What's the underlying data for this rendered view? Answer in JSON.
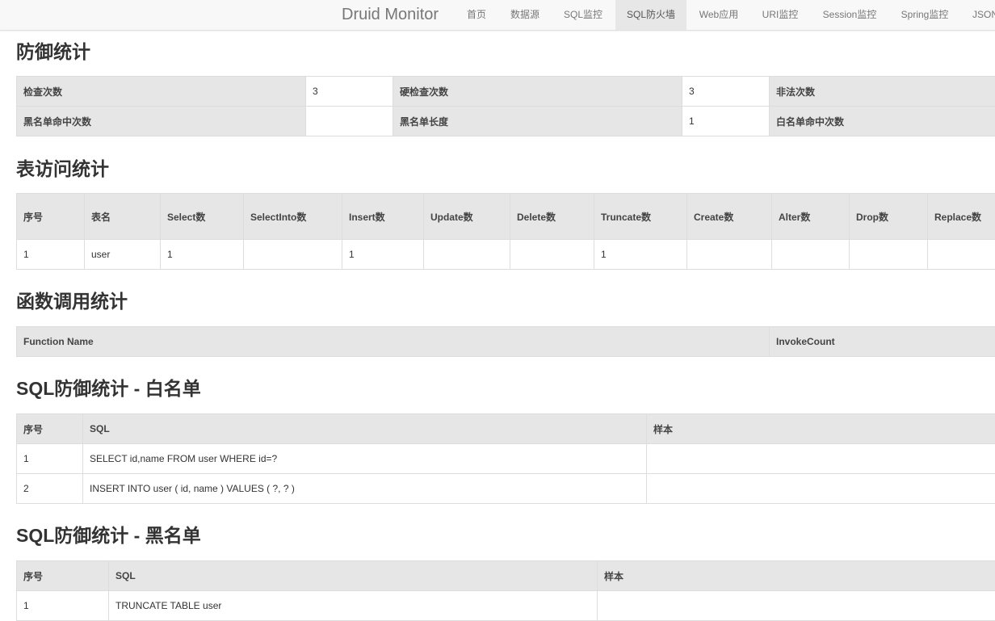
{
  "navbar": {
    "brand": "Druid Monitor",
    "items": [
      {
        "label": "首页"
      },
      {
        "label": "数据源"
      },
      {
        "label": "SQL监控"
      },
      {
        "label": "SQL防火墙"
      },
      {
        "label": "Web应用"
      },
      {
        "label": "URI监控"
      },
      {
        "label": "Session监控"
      },
      {
        "label": "Spring监控"
      },
      {
        "label": "JSON"
      }
    ],
    "active_item": "SQL防火墙"
  },
  "defense": {
    "title": "防御统计",
    "rows": [
      [
        {
          "label": "检查次数",
          "value": "3"
        },
        {
          "label": "硬检查次数",
          "value": "3"
        },
        {
          "label": "非法次数",
          "value": ""
        }
      ],
      [
        {
          "label": "黑名单命中次数",
          "value": ""
        },
        {
          "label": "黑名单长度",
          "value": "1"
        },
        {
          "label": "白名单命中次数",
          "value": ""
        }
      ]
    ]
  },
  "table_access": {
    "title": "表访问统计",
    "headers": [
      "序号",
      "表名",
      "Select数",
      "SelectInto数",
      "Insert数",
      "Update数",
      "Delete数",
      "Truncate数",
      "Create数",
      "Alter数",
      "Drop数",
      "Replace数"
    ],
    "rows": [
      [
        "1",
        "user",
        "1",
        "",
        "1",
        "",
        "",
        "1",
        "",
        "",
        "",
        ""
      ]
    ]
  },
  "functions": {
    "title": "函数调用统计",
    "headers": [
      "Function Name",
      "InvokeCount"
    ],
    "rows": []
  },
  "whitelist": {
    "title": "SQL防御统计 - 白名单",
    "headers": [
      "序号",
      "SQL",
      "样本"
    ],
    "rows": [
      [
        "1",
        "SELECT id,name FROM user WHERE id=?",
        ""
      ],
      [
        "2",
        "INSERT INTO user ( id, name ) VALUES ( ?, ? )",
        ""
      ]
    ]
  },
  "blacklist": {
    "title": "SQL防御统计 - 黑名单",
    "headers": [
      "序号",
      "SQL",
      "样本"
    ],
    "rows": [
      [
        "1",
        "TRUNCATE TABLE user",
        ""
      ]
    ]
  }
}
